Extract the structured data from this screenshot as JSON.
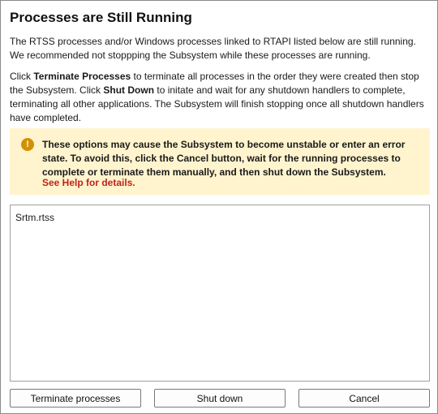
{
  "dialog": {
    "title": "Processes are Still Running",
    "para1": "The RTSS processes and/or Windows processes linked to RTAPI listed below are still running. We recommended not stoppping the Subsystem while these processes are running.",
    "para2": {
      "p1": "Click ",
      "terminate_bold": "Terminate Processes",
      "p2": " to terminate all processes in the order they were created then stop the Subsystem. Click ",
      "shutdown_bold": "Shut Down",
      "p3": " to initate and wait for any shutdown handlers to complete, terminating all other applications. The Subsystem will finish stopping once all shutdown handlers have completed."
    },
    "warning": {
      "icon": "!",
      "text": "These options may cause the Subsystem to become unstable or enter an error state. To avoid this, click the Cancel button, wait for the running processes to complete or terminate them manually, and then shut down the Subsystem.",
      "link": "See Help for details."
    },
    "processes": [
      "Srtm.rtss"
    ],
    "buttons": {
      "terminate": "Terminate processes",
      "shutdown": "Shut down",
      "cancel": "Cancel"
    }
  }
}
